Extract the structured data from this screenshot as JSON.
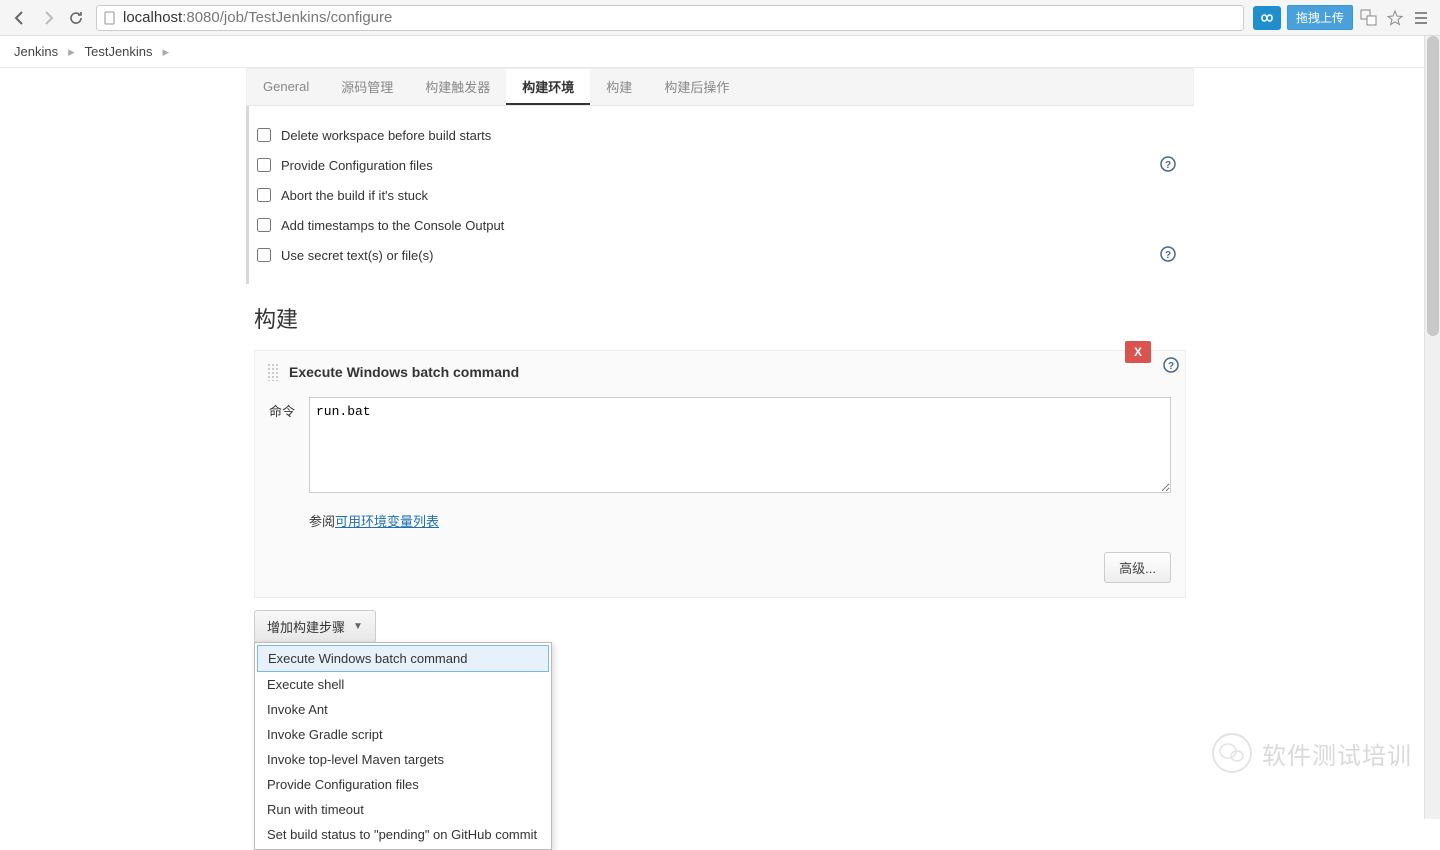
{
  "browser": {
    "url_host": "localhost",
    "url_port_path": ":8080/job/TestJenkins/configure",
    "ext_btn_label": "拖拽上传"
  },
  "breadcrumb": {
    "items": [
      "Jenkins",
      "TestJenkins"
    ]
  },
  "tabs": {
    "items": [
      {
        "label": "General",
        "active": false
      },
      {
        "label": "源码管理",
        "active": false
      },
      {
        "label": "构建触发器",
        "active": false
      },
      {
        "label": "构建环境",
        "active": true
      },
      {
        "label": "构建",
        "active": false
      },
      {
        "label": "构建后操作",
        "active": false
      }
    ]
  },
  "build_env": {
    "options": [
      {
        "label": "Delete workspace before build starts",
        "checked": false,
        "help": false
      },
      {
        "label": "Provide Configuration files",
        "checked": false,
        "help": true
      },
      {
        "label": "Abort the build if it's stuck",
        "checked": false,
        "help": false
      },
      {
        "label": "Add timestamps to the Console Output",
        "checked": false,
        "help": false
      },
      {
        "label": "Use secret text(s) or file(s)",
        "checked": false,
        "help": true
      }
    ]
  },
  "build": {
    "title": "构建",
    "step": {
      "title": "Execute Windows batch command",
      "field_label": "命令",
      "command": "run.bat",
      "ref_prefix": "参阅 ",
      "ref_link": "可用环境变量列表",
      "advanced_label": "高级...",
      "delete_label": "X"
    },
    "add_step_label": "增加构建步骤",
    "dropdown": [
      "Execute Windows batch command",
      "Execute shell",
      "Invoke Ant",
      "Invoke Gradle script",
      "Invoke top-level Maven targets",
      "Provide Configuration files",
      "Run with timeout",
      "Set build status to \"pending\" on GitHub commit"
    ]
  },
  "watermark": {
    "text": "软件测试培训"
  }
}
